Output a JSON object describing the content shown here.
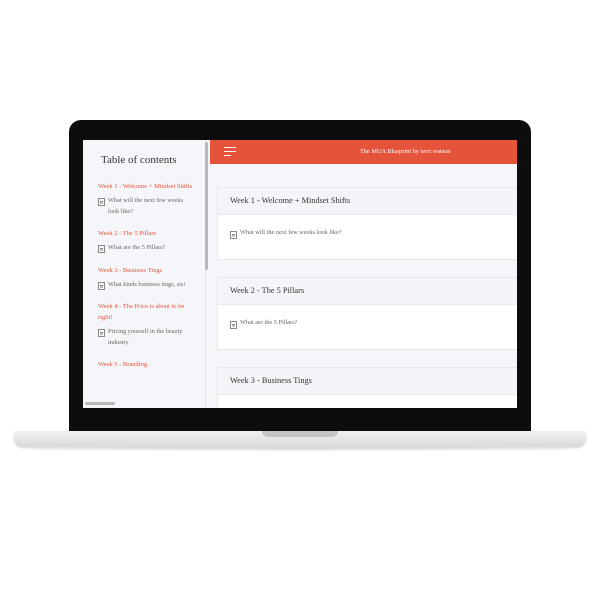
{
  "sidebar": {
    "title": "Table of contents",
    "items": [
      {
        "week": "Week 1 - Welcome + Mindset Shifts",
        "lesson": "What will the next few weeks look like?"
      },
      {
        "week": "Week 2 - The 5 Pillars",
        "lesson": "What are the 5 Pillars?"
      },
      {
        "week": "Week 3 - Business Tings",
        "lesson": "What kinds business tings, sis!"
      },
      {
        "week": "Week 4 - The Price is about to be right!",
        "lesson": "Pricing yourself in the beauty industry"
      },
      {
        "week": "Week 5 - Branding",
        "lesson": ""
      }
    ]
  },
  "header": {
    "title": "The MUA Blueprint by terri watson"
  },
  "main": {
    "cards": [
      {
        "title": "Week 1 - Welcome + Mindset Shifts",
        "lesson": "What will the next few weeks look like?"
      },
      {
        "title": "Week 2 - The 5 Pillars",
        "lesson": "What are the 5 Pillars?"
      },
      {
        "title": "Week 3 - Business Tings",
        "lesson": ""
      }
    ]
  },
  "colors": {
    "accent": "#e5533b",
    "background": "#f5f6f9",
    "laptop_frame": "#0d0d0d"
  },
  "icons": [
    "menu-icon",
    "document-icon"
  ]
}
